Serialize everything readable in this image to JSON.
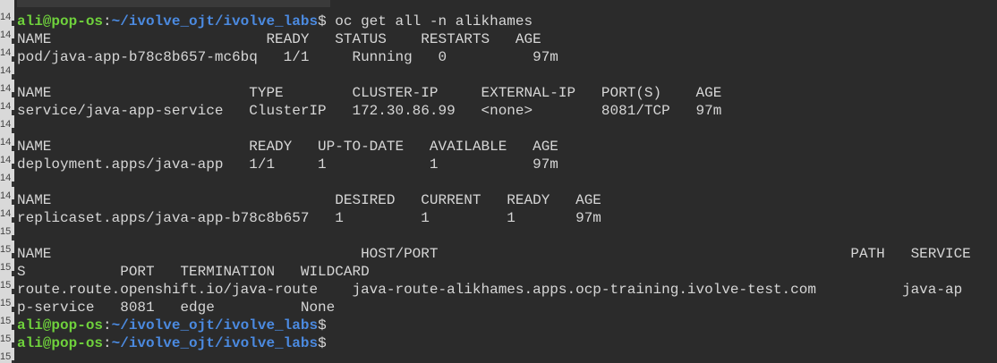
{
  "prompt": {
    "user_host": "ali@pop-os",
    "separator": ":",
    "path": "~/ivolve_ojt/ivolve_labs",
    "symbol": "$"
  },
  "gutter_labels": [
    "14",
    "14",
    "14",
    "14",
    "14",
    "14",
    "14",
    "14",
    "14",
    "14",
    "14",
    "14",
    "15",
    "15",
    "15",
    "15",
    "15",
    "15",
    "15",
    "15"
  ],
  "command": " oc get all -n alikhames",
  "output": [
    "NAME                         READY   STATUS    RESTARTS   AGE",
    "pod/java-app-b78c8b657-mc6bq   1/1     Running   0          97m",
    "",
    "NAME                       TYPE        CLUSTER-IP     EXTERNAL-IP   PORT(S)    AGE",
    "service/java-app-service   ClusterIP   172.30.86.99   <none>        8081/TCP   97m",
    "",
    "NAME                       READY   UP-TO-DATE   AVAILABLE   AGE",
    "deployment.apps/java-app   1/1     1            1           97m",
    "",
    "NAME                                 DESIRED   CURRENT   READY   AGE",
    "replicaset.apps/java-app-b78c8b657   1         1         1       97m",
    "",
    "NAME                                    HOST/PORT                                                PATH   SERVICE",
    "S           PORT   TERMINATION   WILDCARD",
    "route.route.openshift.io/java-route    java-route-alikhames.apps.ocp-training.ivolve-test.com          java-ap",
    "p-service   8081   edge          None"
  ]
}
